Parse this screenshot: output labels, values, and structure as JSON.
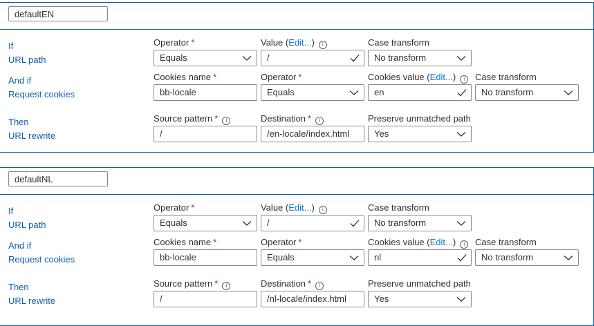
{
  "rules": [
    {
      "name": "defaultEN",
      "condition1": {
        "prefix": "If",
        "type": "URL path",
        "operator_label": "Operator",
        "operator": "Equals",
        "value_label": "Value",
        "value_edit": "Edit...",
        "value": "/",
        "case_label": "Case transform",
        "case": "No transform"
      },
      "condition2": {
        "prefix": "And if",
        "type": "Request cookies",
        "cookies_name_label": "Cookies name",
        "cookies_name": "bb-locale",
        "operator_label": "Operator",
        "operator": "Equals",
        "cookies_value_label": "Cookies value",
        "cookies_value_edit": "Edit...",
        "cookies_value": "en",
        "case_label": "Case transform",
        "case": "No transform"
      },
      "action": {
        "prefix": "Then",
        "type": "URL rewrite",
        "source_label": "Source pattern",
        "source": "/",
        "destination_label": "Destination",
        "destination": "/en-locale/index.html",
        "preserve_label": "Preserve unmatched path",
        "preserve": "Yes"
      }
    },
    {
      "name": "defaultNL",
      "condition1": {
        "prefix": "If",
        "type": "URL path",
        "operator_label": "Operator",
        "operator": "Equals",
        "value_label": "Value",
        "value_edit": "Edit...",
        "value": "/",
        "case_label": "Case transform",
        "case": "No transform"
      },
      "condition2": {
        "prefix": "And if",
        "type": "Request cookies",
        "cookies_name_label": "Cookies name",
        "cookies_name": "bb-locale",
        "operator_label": "Operator",
        "operator": "Equals",
        "cookies_value_label": "Cookies value",
        "cookies_value_edit": "Edit...",
        "cookies_value": "nl",
        "case_label": "Case transform",
        "case": "No transform"
      },
      "action": {
        "prefix": "Then",
        "type": "URL rewrite",
        "source_label": "Source pattern",
        "source": "/",
        "destination_label": "Destination",
        "destination": "/nl-locale/index.html",
        "preserve_label": "Preserve unmatched path",
        "preserve": "Yes"
      }
    }
  ],
  "icons": {
    "dropdown": "chevron-down-icon",
    "combo_accept": "checkmark-icon",
    "info": "info-icon"
  },
  "colors": {
    "accent_border": "#0f5ea8",
    "link": "#0f78d4",
    "required": "#a4262c"
  }
}
